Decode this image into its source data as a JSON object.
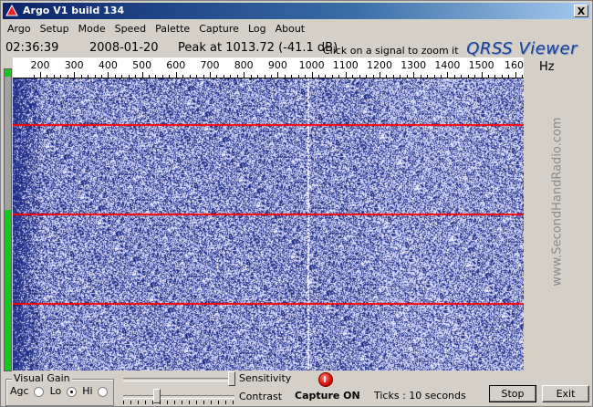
{
  "window": {
    "title": "Argo V1 build 134",
    "close_glyph": "X"
  },
  "menu": [
    "Argo",
    "Setup",
    "Mode",
    "Speed",
    "Palette",
    "Capture",
    "Log",
    "About"
  ],
  "info": {
    "time": "02:36:39",
    "date": "2008-01-20",
    "peak": "Peak at 1013.72 (-41.1 dB)",
    "hint": "Click on a signal to zoom it",
    "brand": "QRSS Viewer"
  },
  "scale": {
    "labels": [
      "200",
      "300",
      "400",
      "500",
      "600",
      "700",
      "800",
      "900",
      "1000",
      "1100",
      "1200",
      "1300",
      "1400",
      "1500",
      "160"
    ],
    "unit": "Hz"
  },
  "watermark": "www.SecondHandRadio.com",
  "controls": {
    "visual_gain_legend": "Visual Gain",
    "agc_label": "Agc",
    "lo_label": "Lo",
    "hi_label": "Hi",
    "selected_gain": "Lo",
    "sensitivity_label": "Sensitivity",
    "contrast_label": "Contrast",
    "capture_status": "Capture ON",
    "ticks_text": "Ticks   : 10 seconds",
    "stop_label": "Stop",
    "exit_label": "Exit"
  },
  "colors": {
    "waterfall_base": "#3b4aa0",
    "signal_line": "#ff0000",
    "level_meter": "#12c81a",
    "title_bar": "#0a246a"
  },
  "icons": {
    "app": "argo-triangle-icon",
    "capture": "record-led-icon"
  }
}
